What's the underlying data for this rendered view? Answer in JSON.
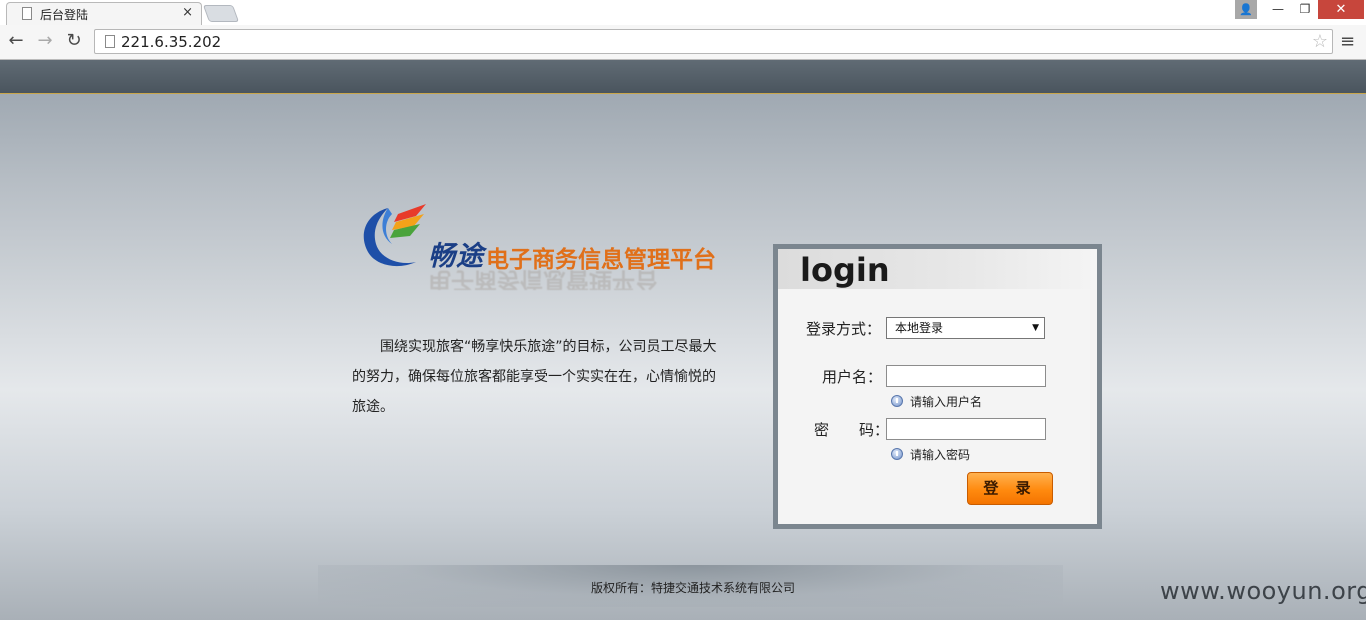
{
  "browser": {
    "tab_title": "后台登陆",
    "tab_close": "×",
    "url": "221.6.35.202",
    "nav": {
      "back": "←",
      "forward": "→",
      "reload": "↻"
    },
    "star": "☆",
    "menu": "≡",
    "window": {
      "user": "👤",
      "minimize": "—",
      "restore": "❐",
      "close": "✕"
    }
  },
  "logo": {
    "brand": "畅途",
    "subtitle": "电子商务信息管理平台",
    "colors": {
      "brand": "#1b3f86",
      "subtitle": "#e0701a"
    }
  },
  "intro": {
    "text": "围绕实现旅客“畅享快乐旅途”的目标，公司员工尽最大的努力，确保每位旅客都能享受一个实实在在，心情愉悦的旅途。"
  },
  "login": {
    "title": "login",
    "method_label": "登录方式：",
    "method_value": "本地登录",
    "username_label": "用户名：",
    "username_value": "",
    "username_hint": "请输入用户名",
    "password_label": "密　　码：",
    "password_value": "",
    "password_hint": "请输入密码",
    "submit_label": "登 录",
    "colors": {
      "button": "#ff8a0f",
      "frame": "#7b868f"
    }
  },
  "footer": {
    "copyright": "版权所有：特捷交通技术系统有限公司"
  },
  "watermark": "www.wooyun.org"
}
